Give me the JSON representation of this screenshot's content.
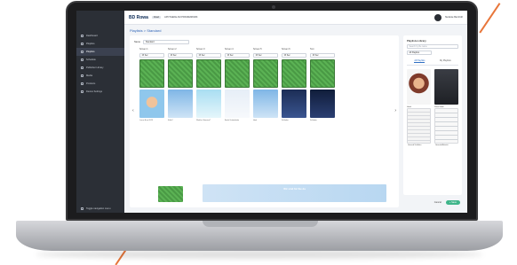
{
  "colors": {
    "accent": "#3166b8",
    "save": "#3fb58a",
    "sidebar": "#2b2f36",
    "decor_line": "#e8763a"
  },
  "topbar": {
    "logo_text": "BD Rowa",
    "env_tag": "Cloud",
    "org_name": "APOTHEKE AM PRINZENPARK",
    "user_name": "Stefanie Bernhöft"
  },
  "sidebar": {
    "items": [
      {
        "label": "Dashboard",
        "icon": "dashboard-icon"
      },
      {
        "label": "Playlists",
        "icon": "playlist-icon"
      },
      {
        "label": "Playlists",
        "icon": "screen-icon"
      },
      {
        "label": "Schedule",
        "icon": "calendar-icon"
      },
      {
        "label": "Publisher Library",
        "icon": "library-icon"
      },
      {
        "label": "Media",
        "icon": "media-icon"
      },
      {
        "label": "Products",
        "icon": "tag-icon"
      },
      {
        "label": "Device Settings",
        "icon": "gear-icon"
      }
    ],
    "footer": "Toggle navigation menu"
  },
  "breadcrumb": "Playlists > Standard",
  "editor": {
    "name_label": "Name",
    "name_value": "Standard",
    "columns": [
      {
        "head": "Screen 1",
        "select": "15 Sec"
      },
      {
        "head": "Screen 2",
        "select": "15 Sec"
      },
      {
        "head": "Screen 3",
        "select": "15 Sec"
      },
      {
        "head": "Screen 4",
        "select": "15 Sec"
      },
      {
        "head": "Screen 5",
        "select": "15 Sec"
      },
      {
        "head": "Screen 6",
        "select": "15 Sec"
      },
      {
        "head": "Text",
        "select": "15 Sec"
      }
    ],
    "row2_captions": [
      "Luxus Erco 2023",
      "Kälte?",
      "Welche Vitamine?",
      "Bockt Schokolade",
      "Heal",
      "Schlafen",
      "Schlafen"
    ],
    "banner_text": "Wir sind für Sie da"
  },
  "library": {
    "title": "Playlists-Library",
    "search_placeholder": "Search by file name",
    "filter_value": "All Playlists",
    "tabs": [
      "All Playlists",
      "My Playlists"
    ],
    "cards": [
      "Hawk",
      "Rowa Mobil",
      "Gesund Schlafen",
      "Gesund Aktivität"
    ]
  },
  "actions": {
    "cancel": "Cancel",
    "save": "+ Save"
  }
}
